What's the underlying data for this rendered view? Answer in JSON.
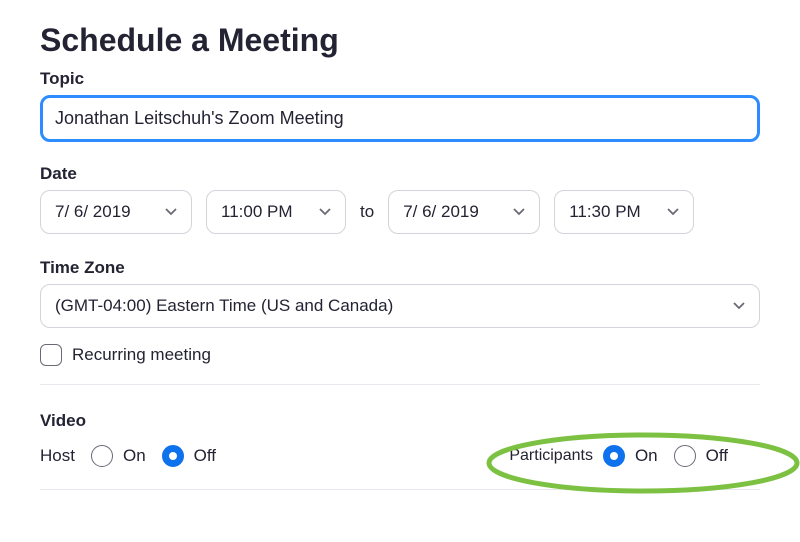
{
  "title": "Schedule a Meeting",
  "topic": {
    "label": "Topic",
    "value": "Jonathan Leitschuh's Zoom Meeting"
  },
  "date": {
    "label": "Date",
    "start_date": "7/  6/ 2019",
    "start_time": "11:00 PM",
    "to": "to",
    "end_date": "7/  6/ 2019",
    "end_time": "11:30 PM"
  },
  "timezone": {
    "label": "Time Zone",
    "value": "(GMT-04:00) Eastern Time (US and Canada)"
  },
  "recurring": {
    "label": "Recurring meeting",
    "checked": false
  },
  "video": {
    "label": "Video",
    "host": {
      "label": "Host",
      "on": "On",
      "off": "Off",
      "selected": "off"
    },
    "participants": {
      "label": "Participants",
      "on": "On",
      "off": "Off",
      "selected": "on"
    }
  }
}
